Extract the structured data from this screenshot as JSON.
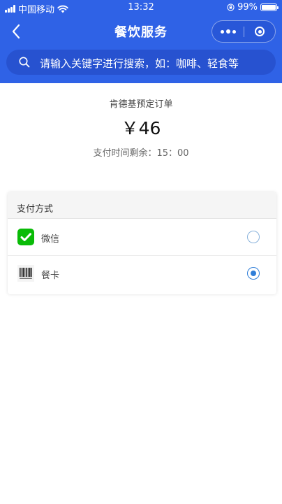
{
  "status_bar": {
    "carrier": "中国移动",
    "time": "13:32",
    "battery": "99%"
  },
  "nav": {
    "title": "餐饮服务"
  },
  "search": {
    "placeholder": "请输入关键字进行搜索，如：咖啡、轻食等"
  },
  "order": {
    "name": "肯德基预定订单",
    "amount": "￥46",
    "countdown": "支付时间剩余：15：00"
  },
  "payment": {
    "section_title": "支付方式",
    "methods": [
      {
        "label": "微信",
        "icon": "wechat-icon",
        "selected": false
      },
      {
        "label": "餐卡",
        "icon": "barcode-card-icon",
        "selected": true
      }
    ]
  },
  "colors": {
    "header_bg": "#2f62e6",
    "search_bg": "#2752d0",
    "wechat_green": "#09bb07",
    "radio_selected": "#2f7ed8"
  }
}
